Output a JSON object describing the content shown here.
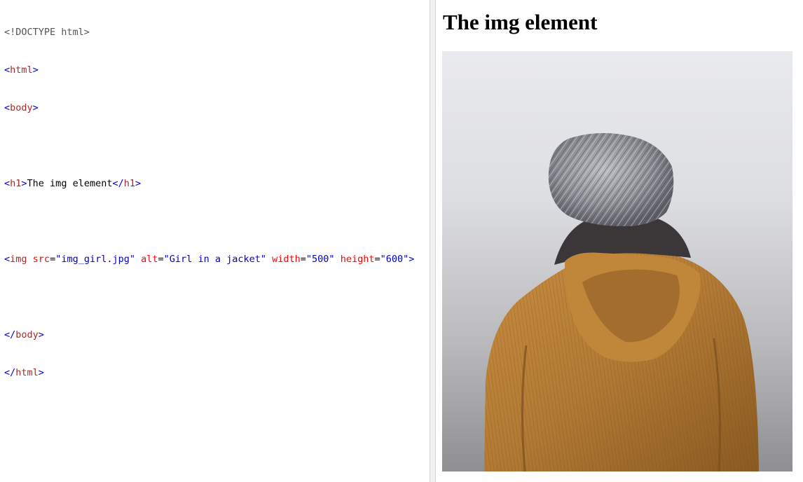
{
  "editor": {
    "doctype": "<!DOCTYPE html>",
    "tags": {
      "html": "html",
      "body": "body",
      "h1": "h1",
      "img": "img"
    },
    "h1_text": "The img element",
    "img_attrs": [
      {
        "name": "src",
        "value": "\"img_girl.jpg\""
      },
      {
        "name": "alt",
        "value": "\"Girl in a jacket\""
      },
      {
        "name": "width",
        "value": "\"500\""
      },
      {
        "name": "height",
        "value": "\"600\""
      }
    ]
  },
  "result": {
    "title": "The img element",
    "image": {
      "alt": "Girl in a jacket",
      "description_icon": "photo-girl-in-jacket",
      "colors": {
        "sky_top": "#e9eaee",
        "sky_bottom": "#9b9b9d",
        "jacket": "#b27a34",
        "jacket_dark": "#7a4e1c",
        "hat": "#8d8e95",
        "scarf": "#3b3638"
      }
    }
  },
  "colors": {
    "tag_bracket": "#0000cd",
    "tag_name": "#a52a2a",
    "attr_name": "#ff0000",
    "attr_value": "#0000cd",
    "doctype": "#555555",
    "splitter": "#f1f1f1"
  }
}
